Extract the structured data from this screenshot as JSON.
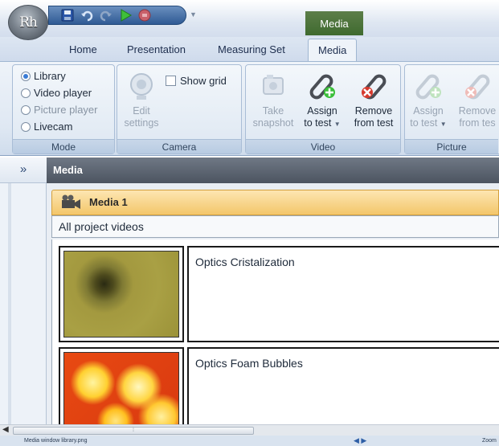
{
  "app": {
    "orb_text": "Rh",
    "context_tab": "Media"
  },
  "tabs": [
    {
      "label": "Home"
    },
    {
      "label": "Presentation"
    },
    {
      "label": "Measuring Set"
    },
    {
      "label": "Media",
      "active": true
    }
  ],
  "ribbon": {
    "mode": {
      "label": "Mode",
      "options": [
        {
          "label": "Library",
          "selected": true
        },
        {
          "label": "Video player",
          "selected": false
        },
        {
          "label": "Picture player",
          "selected": false
        },
        {
          "label": "Livecam",
          "selected": false
        }
      ]
    },
    "camera": {
      "label": "Camera",
      "edit_settings": {
        "line1": "Edit",
        "line2": "settings"
      },
      "show_grid": "Show grid"
    },
    "video": {
      "label": "Video",
      "take_snapshot": {
        "line1": "Take",
        "line2": "snapshot"
      },
      "assign_to_test": {
        "line1": "Assign",
        "line2": "to test"
      },
      "remove_from_test": {
        "line1": "Remove",
        "line2": "from test"
      }
    },
    "picture": {
      "label": "Picture",
      "assign_to_test": {
        "line1": "Assign",
        "line2": "to test"
      },
      "remove_from_test": {
        "line1": "Remove",
        "line2": "from tes"
      }
    }
  },
  "leftpane": {
    "expand_glyph": "»"
  },
  "media": {
    "header": "Media",
    "panel_title": "Media 1",
    "filter": "All project videos",
    "items": [
      {
        "title": "Optics Cristalization"
      },
      {
        "title": "Optics Foam Bubbles"
      }
    ]
  },
  "statusbar": {
    "file": "Media window library.png",
    "zoom": "Zoom"
  },
  "icons": [
    "save-icon",
    "undo-icon",
    "redo-icon",
    "play-icon",
    "stop-icon",
    "camera-icon",
    "assign-icon",
    "remove-icon",
    "film-camera-icon"
  ],
  "colors": {
    "context_green": "#4f7a3c",
    "panel_orange": "#f3c66a",
    "header_gray": "#5c6470"
  }
}
